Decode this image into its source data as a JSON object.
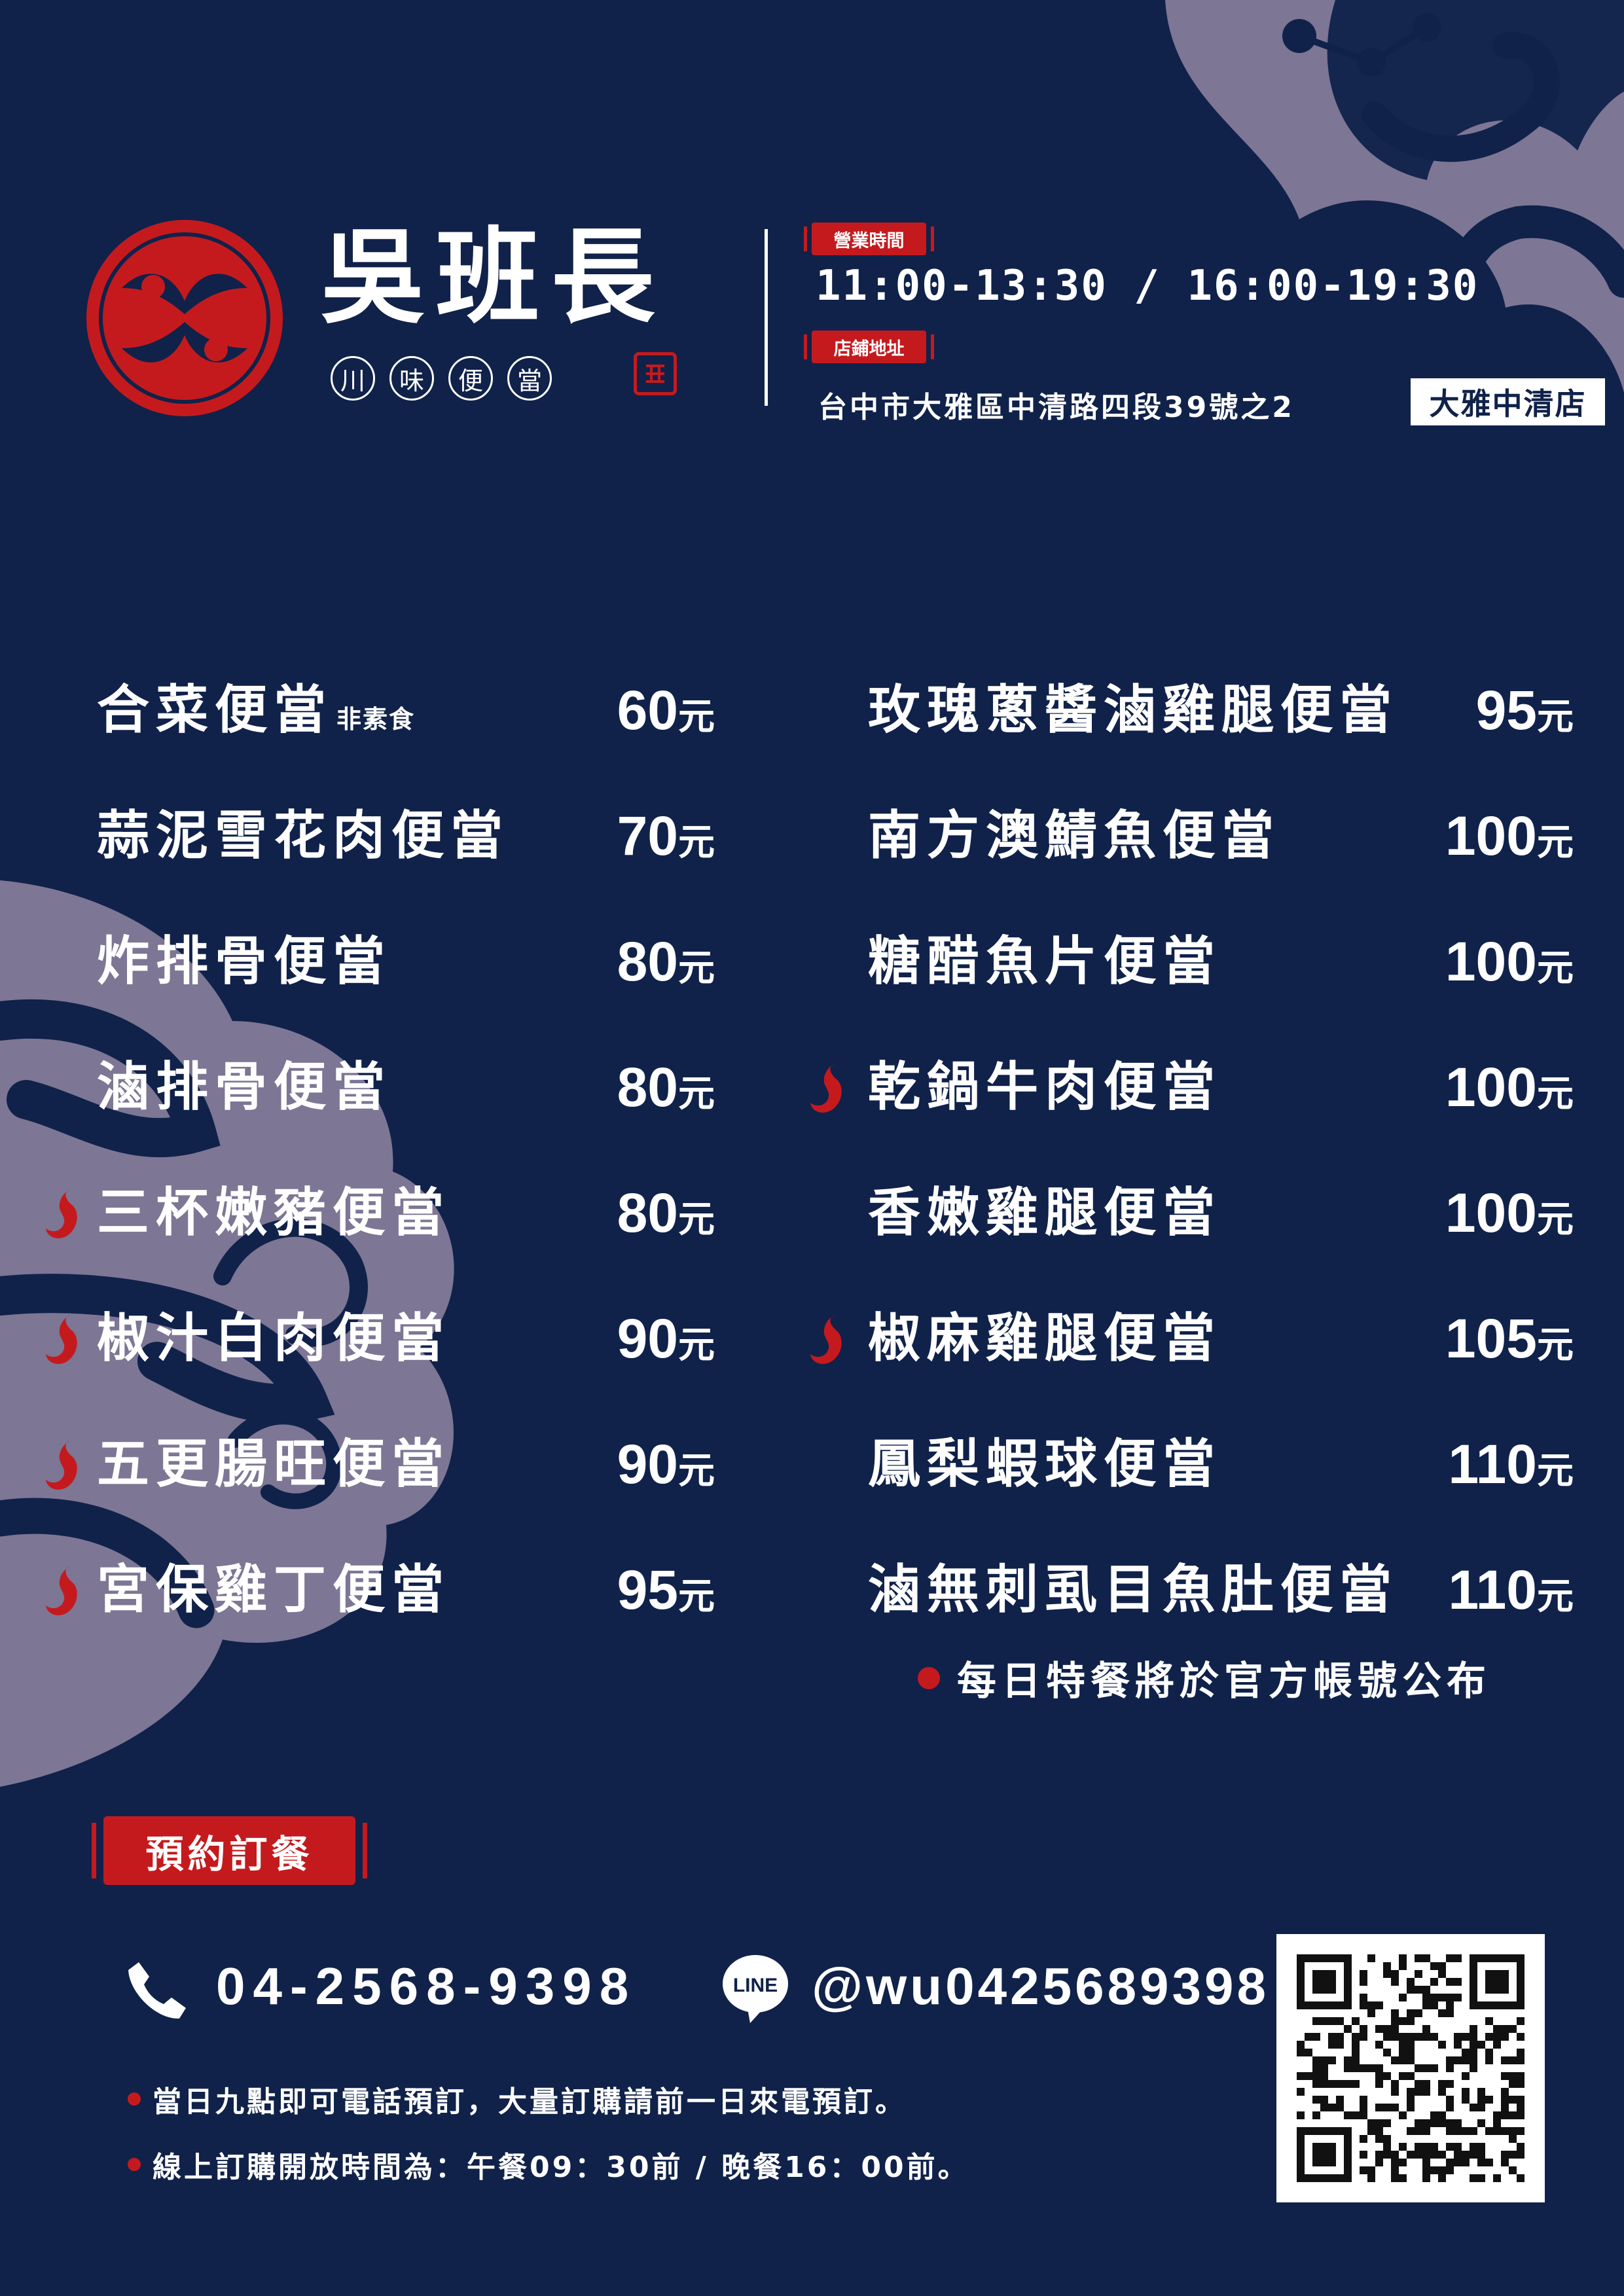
{
  "colors": {
    "background": "#10224a",
    "accent_red": "#c41a1e",
    "decor_lavender": "#7d7694",
    "text": "#ffffff"
  },
  "header": {
    "brand_name": "吳班長",
    "brand_subtitle": [
      "川",
      "味",
      "便",
      "當"
    ],
    "hours_label": "營業時間",
    "hours": "11:00-13:30 / 16:00-19:30",
    "address_label": "店鋪地址",
    "address": "台中市大雅區中清路四段39號之2",
    "branch": "大雅中清店"
  },
  "menu": {
    "left": [
      {
        "name": "合菜便當",
        "note": "非素食",
        "price": "60",
        "spicy": false
      },
      {
        "name": "蒜泥雪花肉便當",
        "price": "70",
        "spicy": false
      },
      {
        "name": "炸排骨便當",
        "price": "80",
        "spicy": false
      },
      {
        "name": "滷排骨便當",
        "price": "80",
        "spicy": false
      },
      {
        "name": "三杯嫩豬便當",
        "price": "80",
        "spicy": true
      },
      {
        "name": "椒汁白肉便當",
        "price": "90",
        "spicy": true
      },
      {
        "name": "五更腸旺便當",
        "price": "90",
        "spicy": true
      },
      {
        "name": "宮保雞丁便當",
        "price": "95",
        "spicy": true
      }
    ],
    "right": [
      {
        "name": "玫瑰蔥醬滷雞腿便當",
        "price": "95",
        "spicy": false
      },
      {
        "name": "南方澳鯖魚便當",
        "price": "100",
        "spicy": false
      },
      {
        "name": "糖醋魚片便當",
        "price": "100",
        "spicy": false
      },
      {
        "name": "乾鍋牛肉便當",
        "price": "100",
        "spicy": true
      },
      {
        "name": "香嫩雞腿便當",
        "price": "100",
        "spicy": false
      },
      {
        "name": "椒麻雞腿便當",
        "price": "105",
        "spicy": true
      },
      {
        "name": "鳳梨蝦球便當",
        "price": "110",
        "spicy": false
      },
      {
        "name": "滷無刺虱目魚肚便當",
        "price": "110",
        "spicy": false
      }
    ],
    "currency": "元",
    "daily_special_note": "每日特餐將於官方帳號公布"
  },
  "order": {
    "title": "預約訂餐",
    "phone": "04-2568-9398",
    "line_id": "@wu0425689398",
    "line_icon_label": "LINE",
    "notes": [
      "當日九點即可電話預訂，大量訂購請前一日來電預訂。",
      "線上訂購開放時間為：午餐09：30前 / 晚餐16：00前。"
    ]
  }
}
